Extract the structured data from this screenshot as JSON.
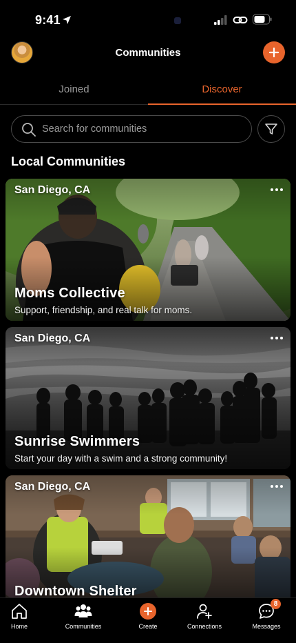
{
  "status_bar": {
    "time": "9:41"
  },
  "header": {
    "title": "Communities"
  },
  "tabs": [
    {
      "label": "Joined",
      "active": false
    },
    {
      "label": "Discover",
      "active": true
    }
  ],
  "search": {
    "placeholder": "Search for communities",
    "value": ""
  },
  "section": {
    "title": "Local Communities"
  },
  "communities": [
    {
      "location": "San Diego, CA",
      "name": "Moms Collective",
      "description": "Support, friendship, and real talk for moms."
    },
    {
      "location": "San Diego, CA",
      "name": "Sunrise Swimmers",
      "description": "Start your day with a swim and a strong community!"
    },
    {
      "location": "San Diego, CA",
      "name": "Downtown Shelter",
      "description": ""
    }
  ],
  "nav": {
    "items": [
      {
        "label": "Home",
        "icon": "home-icon"
      },
      {
        "label": "Communities",
        "icon": "people-icon"
      },
      {
        "label": "Create",
        "icon": "plus-icon"
      },
      {
        "label": "Connections",
        "icon": "add-person-icon"
      },
      {
        "label": "Messages",
        "icon": "chat-icon"
      }
    ],
    "messages_badge": "8"
  },
  "colors": {
    "accent": "#e8642c",
    "background": "#000000",
    "muted_text": "#9a9a9a"
  }
}
